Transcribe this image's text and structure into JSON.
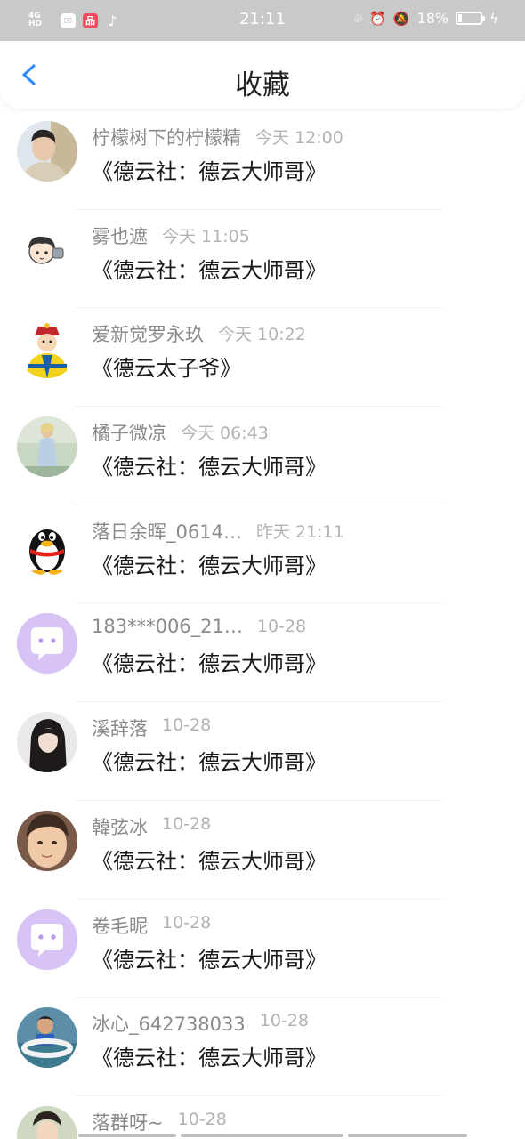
{
  "status_bar": {
    "network": "4G HD",
    "time": "21:11",
    "battery": "18%",
    "battery_level": 0.18,
    "app_icons": [
      "messages-app-icon",
      "red-app-icon",
      "tiktok-icon"
    ],
    "status_icons": [
      "location-icon",
      "alarm-icon",
      "mute-icon",
      "charging-icon"
    ]
  },
  "nav": {
    "title": "收藏",
    "back_icon": "chevron-left-icon",
    "accent": "#2f8ef5"
  },
  "favorites": [
    {
      "name": "柠檬树下的柠檬精",
      "time": "今天 12:00",
      "content": "《德云社：德云大师哥》",
      "avatar": "photo-boy-icon"
    },
    {
      "name": "雾也遮",
      "time": "今天 11:05",
      "content": "《德云社：德云大师哥》",
      "avatar": "cartoon-boy-icon"
    },
    {
      "name": "爱新觉罗永玖",
      "time": "今天 10:22",
      "content": "《德云太子爷》",
      "avatar": "emperor-cartoon-icon"
    },
    {
      "name": "橘子微凉",
      "time": "今天 06:43",
      "content": "《德云社：德云大师哥》",
      "avatar": "photo-girl-outdoor-icon"
    },
    {
      "name": "落日余晖_0614…",
      "time": "昨天 21:11",
      "content": "《德云社：德云大师哥》",
      "avatar": "qq-penguin-icon"
    },
    {
      "name": "183***006_21…",
      "time": "10-28",
      "content": "《德云社：德云大师哥》",
      "avatar": "chat-bubble-icon"
    },
    {
      "name": "溪辞落",
      "time": "10-28",
      "content": "《德云社：德云大师哥》",
      "avatar": "photo-girl-dark-icon"
    },
    {
      "name": "韓弦冰",
      "time": "10-28",
      "content": "《德云社：德云大师哥》",
      "avatar": "photo-girl-face-icon"
    },
    {
      "name": "卷毛昵",
      "time": "10-28",
      "content": "《德云社：德云大师哥》",
      "avatar": "chat-bubble-icon"
    },
    {
      "name": "冰心_642738033",
      "time": "10-28",
      "content": "《德云社：德云大师哥》",
      "avatar": "photo-child-pool-icon"
    },
    {
      "name": "落群呀~",
      "time": "10-28",
      "content": "",
      "avatar": "photo-costume-icon"
    }
  ],
  "colors": {
    "status_bar_bg": "#c9c9c9",
    "name_text": "#8a8a8a",
    "time_text": "#b2b2b2",
    "content_text": "#1a1a1a",
    "chat_avatar_bg": "#d7c3f5"
  }
}
